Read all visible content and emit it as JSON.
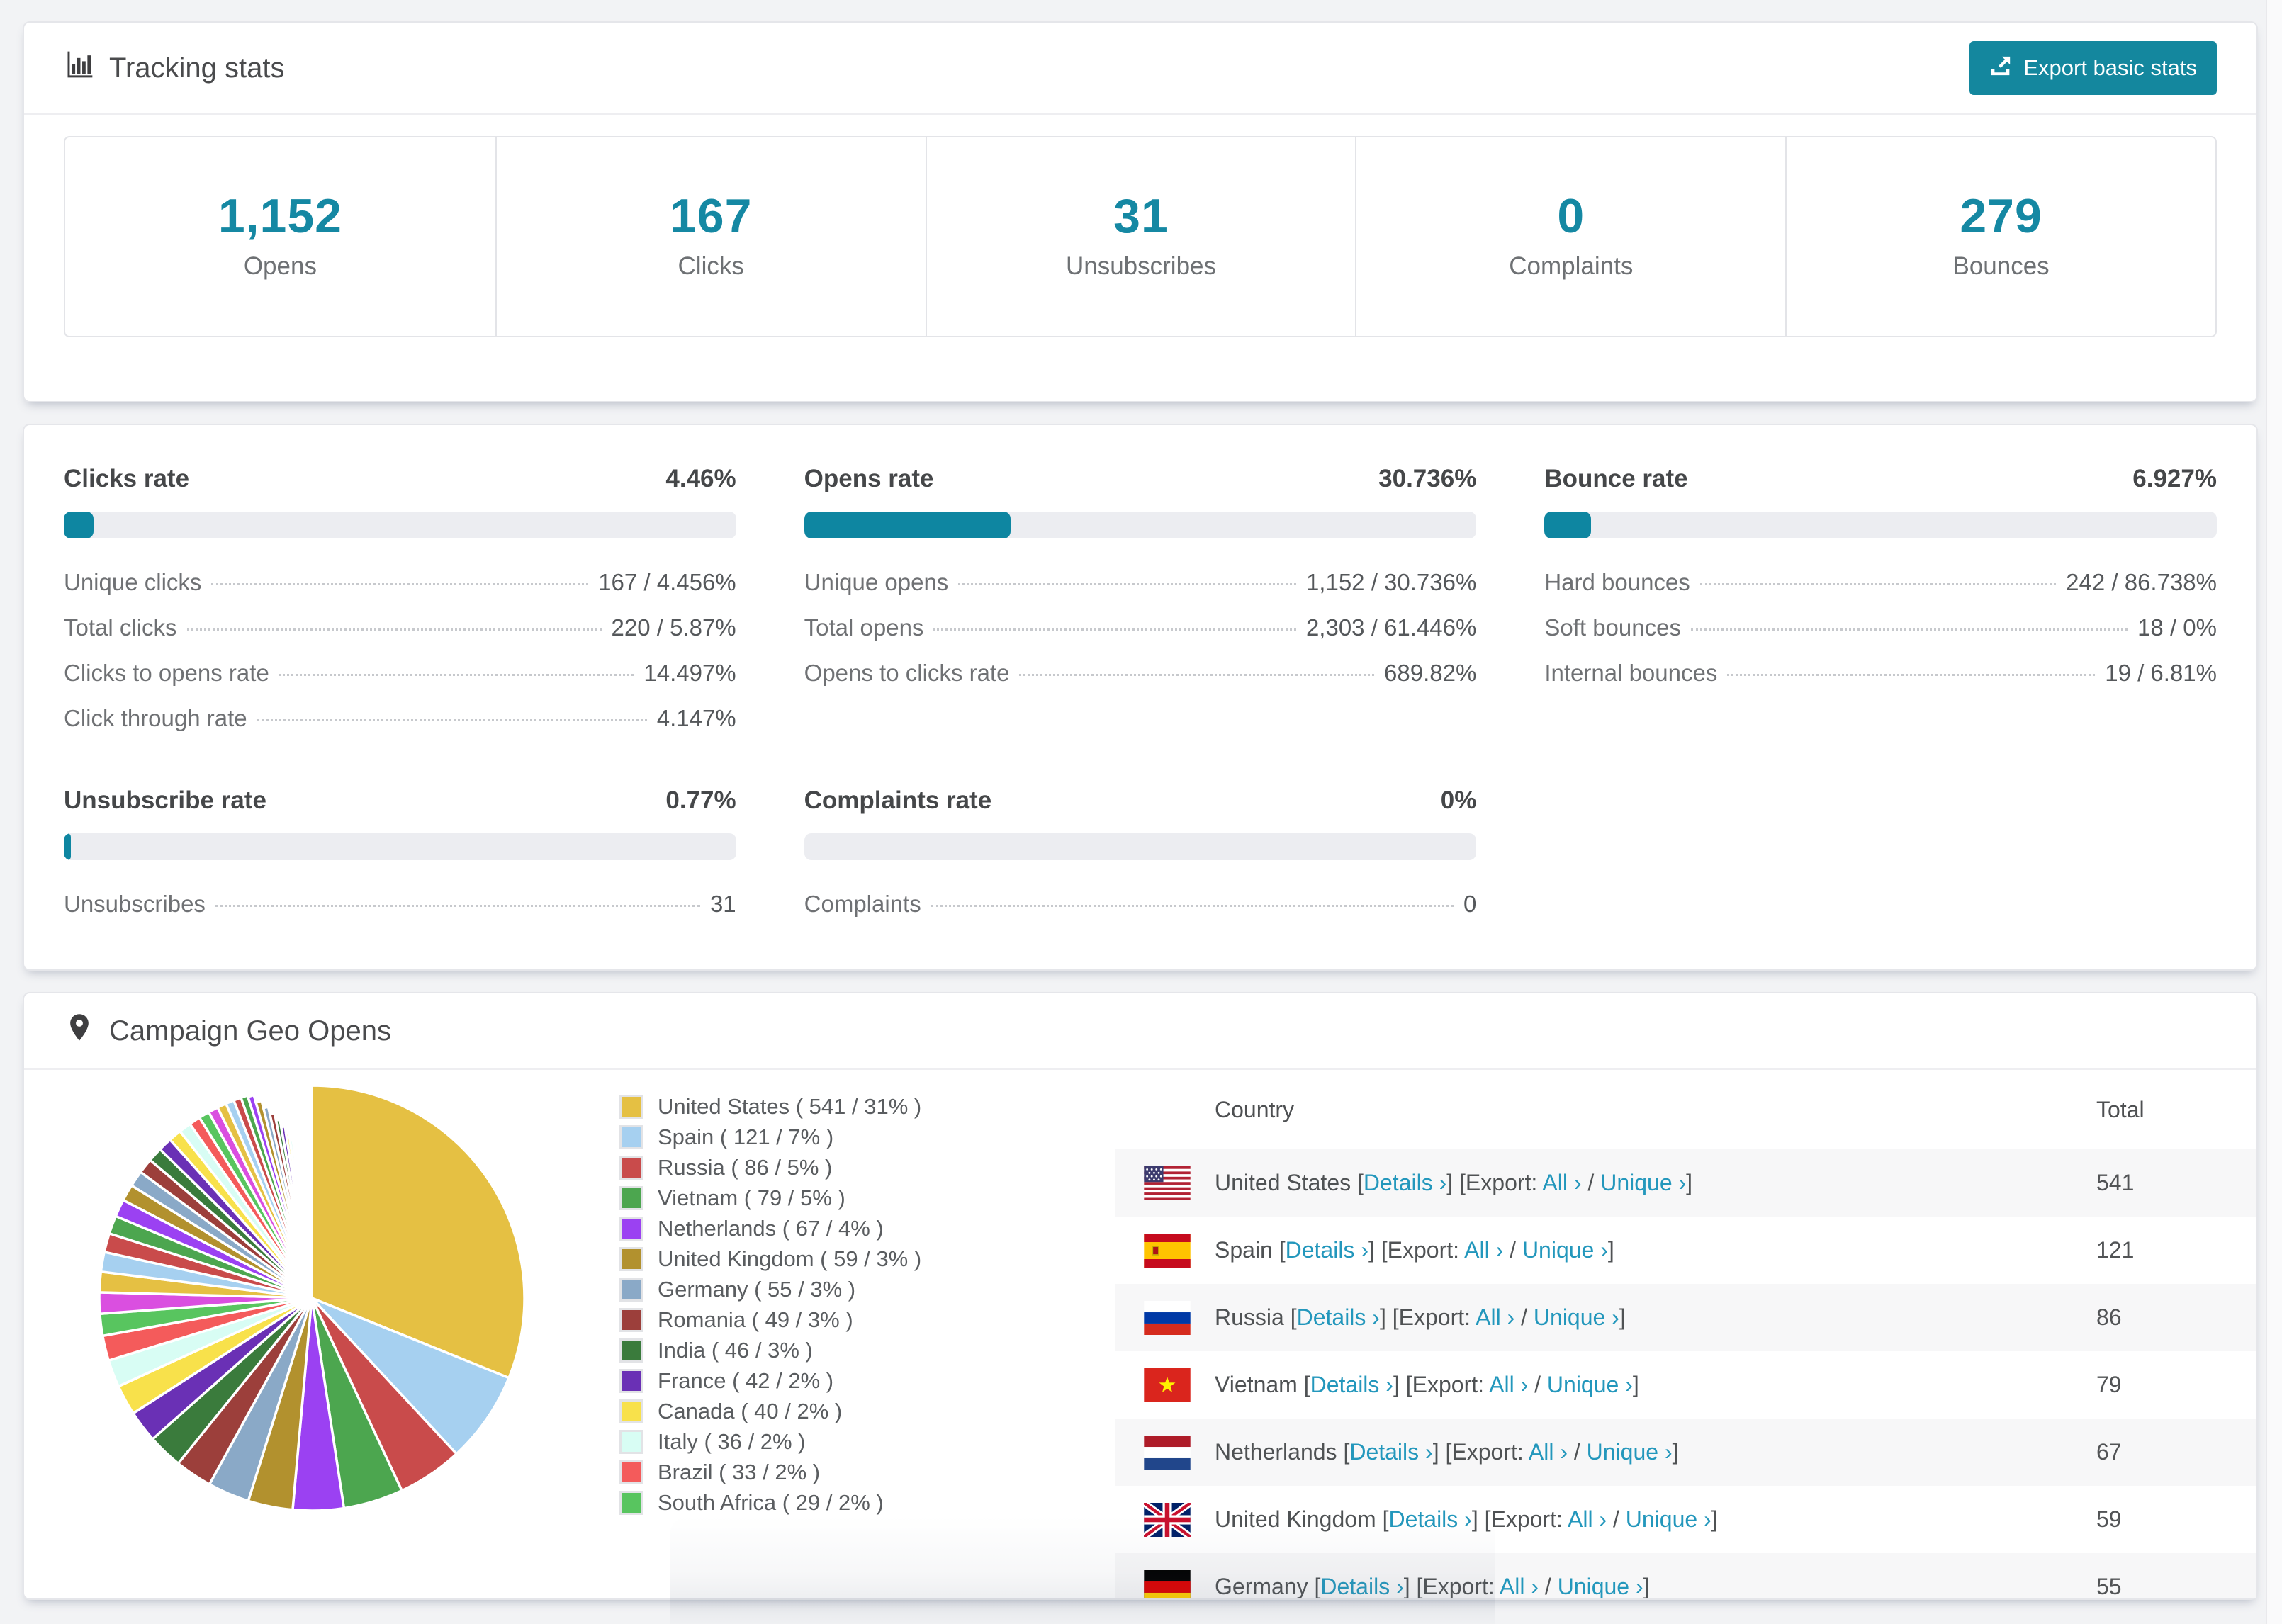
{
  "tracking": {
    "title": "Tracking stats",
    "export_button": "Export basic stats",
    "stats": [
      {
        "value": "1,152",
        "label": "Opens"
      },
      {
        "value": "167",
        "label": "Clicks"
      },
      {
        "value": "31",
        "label": "Unsubscribes"
      },
      {
        "value": "0",
        "label": "Complaints"
      },
      {
        "value": "279",
        "label": "Bounces"
      }
    ]
  },
  "rates": [
    {
      "title": "Clicks rate",
      "value": "4.46%",
      "progress": 4.46,
      "rows": [
        [
          "Unique clicks",
          "167 / 4.456%"
        ],
        [
          "Total clicks",
          "220 / 5.87%"
        ],
        [
          "Clicks to opens rate",
          "14.497%"
        ],
        [
          "Click through rate",
          "4.147%"
        ]
      ]
    },
    {
      "title": "Opens rate",
      "value": "30.736%",
      "progress": 30.736,
      "rows": [
        [
          "Unique opens",
          "1,152 / 30.736%"
        ],
        [
          "Total opens",
          "2,303 / 61.446%"
        ],
        [
          "Opens to clicks rate",
          "689.82%"
        ]
      ]
    },
    {
      "title": "Bounce rate",
      "value": "6.927%",
      "progress": 6.927,
      "rows": [
        [
          "Hard bounces",
          "242 / 86.738%"
        ],
        [
          "Soft bounces",
          "18 / 0%"
        ],
        [
          "Internal bounces",
          "19 / 6.81%"
        ]
      ]
    },
    {
      "title": "Unsubscribe rate",
      "value": "0.77%",
      "progress": 0.77,
      "rows": [
        [
          "Unsubscribes",
          "31"
        ]
      ]
    },
    {
      "title": "Complaints rate",
      "value": "0%",
      "progress": 0,
      "rows": [
        [
          "Complaints",
          "0"
        ]
      ]
    }
  ],
  "geo": {
    "title": "Campaign Geo Opens",
    "table": {
      "headers": [
        "Country",
        "Total"
      ],
      "tokens": {
        "lb": "[",
        "rb": "]",
        "details": "Details ›",
        "export": "Export:",
        "all": "All ›",
        "slash": "/",
        "unique": "Unique ›"
      },
      "rows": [
        {
          "country": "United States",
          "flag": "us",
          "total": "541"
        },
        {
          "country": "Spain",
          "flag": "es",
          "total": "121"
        },
        {
          "country": "Russia",
          "flag": "ru",
          "total": "86"
        },
        {
          "country": "Vietnam",
          "flag": "vn",
          "total": "79"
        },
        {
          "country": "Netherlands",
          "flag": "nl",
          "total": "67"
        },
        {
          "country": "United Kingdom",
          "flag": "uk",
          "total": "59"
        },
        {
          "country": "Germany",
          "flag": "de",
          "total": "55"
        }
      ]
    }
  },
  "chart_data": {
    "type": "pie",
    "title": "Campaign Geo Opens",
    "legend_position": "right",
    "slices": [
      {
        "label": "United States",
        "value": 541,
        "pct": "31%",
        "color": "#E5C043"
      },
      {
        "label": "Spain",
        "value": 121,
        "pct": "7%",
        "color": "#A6D0F0"
      },
      {
        "label": "Russia",
        "value": 86,
        "pct": "5%",
        "color": "#C94B4B"
      },
      {
        "label": "Vietnam",
        "value": 79,
        "pct": "5%",
        "color": "#4CA64F"
      },
      {
        "label": "Netherlands",
        "value": 67,
        "pct": "4%",
        "color": "#9B41F2"
      },
      {
        "label": "United Kingdom",
        "value": 59,
        "pct": "3%",
        "color": "#B2912E"
      },
      {
        "label": "Germany",
        "value": 55,
        "pct": "3%",
        "color": "#8AA9C7"
      },
      {
        "label": "Romania",
        "value": 49,
        "pct": "3%",
        "color": "#9C3F3B"
      },
      {
        "label": "India",
        "value": 46,
        "pct": "3%",
        "color": "#3A7B3C"
      },
      {
        "label": "France",
        "value": 42,
        "pct": "2%",
        "color": "#6A30B5"
      },
      {
        "label": "Canada",
        "value": 40,
        "pct": "2%",
        "color": "#F8E14B"
      },
      {
        "label": "Italy",
        "value": 36,
        "pct": "2%",
        "color": "#D8FDF4"
      },
      {
        "label": "Brazil",
        "value": 33,
        "pct": "2%",
        "color": "#F45B5B"
      },
      {
        "label": "South Africa",
        "value": 29,
        "pct": "2%",
        "color": "#58C55F"
      }
    ],
    "palette": [
      "#E5C043",
      "#A6D0F0",
      "#C94B4B",
      "#4CA64F",
      "#9B41F2",
      "#B2912E",
      "#8AA9C7",
      "#9C3F3B",
      "#3A7B3C",
      "#6A30B5",
      "#F8E14B",
      "#D8FDF4",
      "#F45B5B",
      "#58C55F",
      "#DA4FE0"
    ],
    "other_values": [
      28,
      27,
      26,
      25,
      24,
      23,
      22,
      21,
      20,
      19,
      18,
      17,
      16,
      15,
      14,
      13,
      12,
      11,
      10,
      9,
      8,
      8,
      7,
      7,
      6,
      6,
      5,
      5,
      4,
      4,
      3,
      3,
      3,
      2,
      2,
      2,
      2,
      1,
      1,
      1,
      1,
      1,
      1,
      1,
      1
    ]
  }
}
